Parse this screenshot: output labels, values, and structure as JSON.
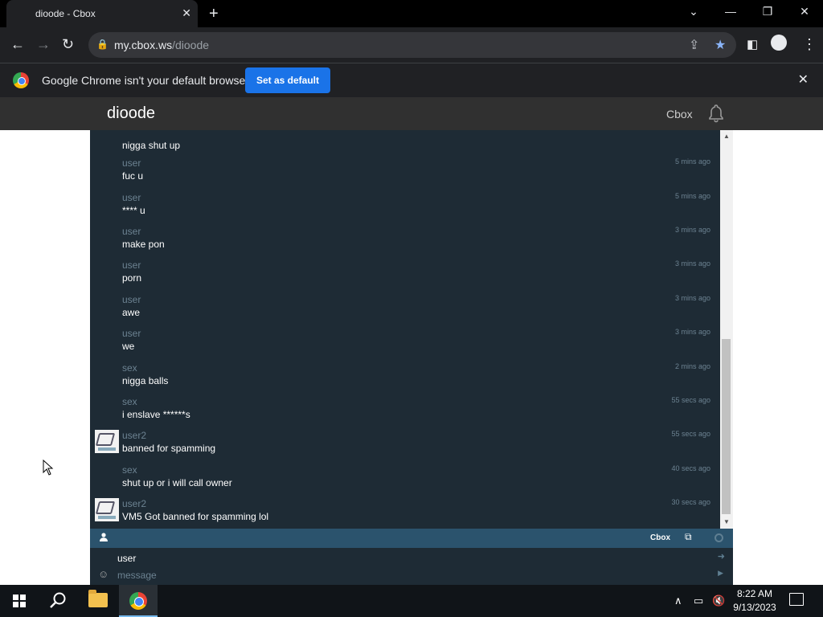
{
  "browser": {
    "tab_title": "dioode - Cbox",
    "url_host": "my.cbox.ws",
    "url_path": "/dioode"
  },
  "infobar": {
    "message": "Google Chrome isn't your default browser",
    "button": "Set as default"
  },
  "site": {
    "title": "dioode",
    "cbox_link": "Cbox"
  },
  "messages": [
    {
      "name": "",
      "text": "nigga shut up",
      "time": "",
      "avatar": false
    },
    {
      "name": "user",
      "text": "fuc u",
      "time": "5 mins ago",
      "avatar": false
    },
    {
      "name": "user",
      "text": "**** u",
      "time": "5 mins ago",
      "avatar": false
    },
    {
      "name": "user",
      "text": "make pon",
      "time": "3 mins ago",
      "avatar": false
    },
    {
      "name": "user",
      "text": "porn",
      "time": "3 mins ago",
      "avatar": false
    },
    {
      "name": "user",
      "text": "awe",
      "time": "3 mins ago",
      "avatar": false
    },
    {
      "name": "user",
      "text": "we",
      "time": "3 mins ago",
      "avatar": false
    },
    {
      "name": "sex",
      "text": "nigga balls",
      "time": "2 mins ago",
      "avatar": false
    },
    {
      "name": "sex",
      "text": "i enslave ******s",
      "time": "55 secs ago",
      "avatar": false
    },
    {
      "name": "user2",
      "text": "banned for spamming",
      "time": "55 secs ago",
      "avatar": true
    },
    {
      "name": "sex",
      "text": "shut up or i will call owner",
      "time": "40 secs ago",
      "avatar": false
    },
    {
      "name": "user2",
      "text": "VM5 Got banned for spamming lol",
      "time": "30 secs ago",
      "avatar": true
    }
  ],
  "footer": {
    "brand": "Cbox"
  },
  "input": {
    "name_value": "user",
    "message_placeholder": "message"
  },
  "taskbar": {
    "time": "8:22 AM",
    "date": "9/13/2023"
  },
  "icons": {
    "user": "user-icon",
    "external": "external-link-icon",
    "emoji": "emoji-icon",
    "bell": "bell-icon"
  },
  "colors": {
    "chat_bg": "#1e2b35",
    "footer_bar": "#2b536d",
    "accent_button": "#1a73e8"
  }
}
